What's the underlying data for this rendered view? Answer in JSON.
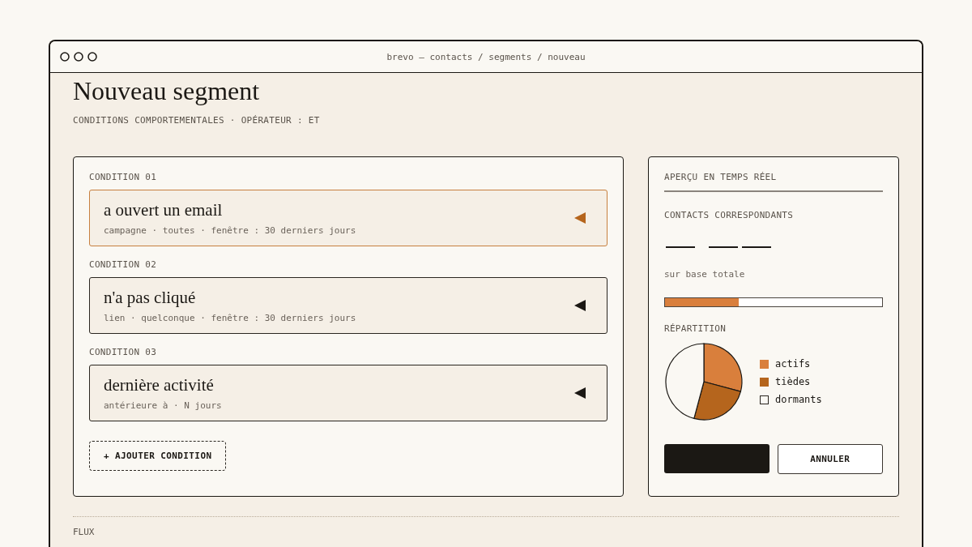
{
  "window": {
    "title": "brevo — contacts / segments / nouveau"
  },
  "page": {
    "title": "Nouveau segment",
    "subtitle": "CONDITIONS COMPORTEMENTALES · OPÉRATEUR : ET"
  },
  "conditions": [
    {
      "label": "CONDITION 01",
      "title": "a ouvert un email",
      "detail": "campagne · toutes · fenêtre : 30 derniers jours",
      "selected": true
    },
    {
      "label": "CONDITION 02",
      "title": "n'a pas cliqué",
      "detail": "lien · quelconque · fenêtre : 30 derniers jours",
      "selected": false
    },
    {
      "label": "CONDITION 03",
      "title": "dernière activité",
      "detail": "antérieure à · N jours",
      "selected": false
    }
  ],
  "add_button": "+ AJOUTER CONDITION",
  "preview": {
    "title": "APERÇU EN TEMPS RÉEL",
    "count_label": "CONTACTS CORRESPONDANTS",
    "base_label": "sur base totale",
    "level": 0.34,
    "breakdown_label": "RÉPARTITION",
    "legend": [
      {
        "label": "actifs",
        "color": "#d97f3c"
      },
      {
        "label": "tièdes",
        "color": "#b5651d"
      },
      {
        "label": "dormants",
        "color": "#faf8f3"
      }
    ],
    "cancel": "ANNULER"
  },
  "flow": {
    "label": "FLUX"
  }
}
